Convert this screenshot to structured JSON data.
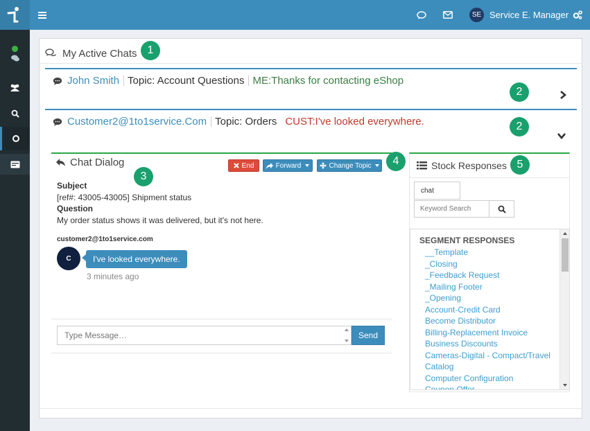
{
  "topbar": {
    "avatar_initials": "SE",
    "user_name": "Service E. Manager"
  },
  "panel": {
    "title": "My Active Chats"
  },
  "chats": [
    {
      "name": "John Smith",
      "topic": "Topic: Account Questions",
      "last_message": "ME:Thanks for contacting eShop",
      "badge": "2",
      "expanded": false
    },
    {
      "name": "Customer2@1to1service.Com",
      "topic": "Topic: Orders",
      "last_message": "CUST:I've looked everywhere.",
      "badge": "2",
      "expanded": true
    }
  ],
  "badges": {
    "one": "1",
    "three": "3",
    "four": "4",
    "five": "5"
  },
  "dialog": {
    "title": "Chat Dialog",
    "end_label": "End",
    "forward_label": "Forward",
    "change_topic_label": "Change Topic",
    "subject_heading": "Subject",
    "subject_value": "[ref#: 43005-43005] Shipment status",
    "question_heading": "Question",
    "question_value": "My order status shows it was delivered, but it's not here.",
    "sender": "customer2@1to1service.com",
    "avatar_letter": "C",
    "message": "I've looked everywhere.",
    "time": "3 minutes ago",
    "input_placeholder": "Type Message…",
    "send_label": "Send"
  },
  "stock": {
    "title": "Stock Responses",
    "tag": "chat",
    "search_placeholder": "Keyword Search",
    "segment_heading": "SEGMENT RESPONSES",
    "items": [
      "__Template",
      "_Closing",
      "_Feedback Request",
      "_Mailing Footer",
      "_Opening",
      "Account-Credit Card",
      "Become Distributor",
      "Billing-Replacement Invoice",
      "Business Discounts",
      "Cameras-Digital - Compact/Travel",
      "Catalog",
      "Computer Configuration",
      "Coupon Offer"
    ]
  },
  "colors": {
    "brand": "#3c8dbc",
    "sidebar": "#222d32",
    "badge": "#1aa06d",
    "accent_green": "#28a745",
    "end_button": "#dd4b39"
  },
  "icons": [
    "logo-icon",
    "status-online-icon",
    "chats-icon",
    "users-icon",
    "search-icon",
    "circle-icon",
    "id-card-icon",
    "hamburger-icon",
    "comment-icon",
    "envelope-icon",
    "cogs-icon",
    "comments-icon",
    "comment-bubble-icon",
    "chevron-right-icon",
    "chevron-down-icon",
    "reply-icon",
    "times-icon",
    "share-icon",
    "arrows-icon",
    "list-icon",
    "search-icon"
  ]
}
